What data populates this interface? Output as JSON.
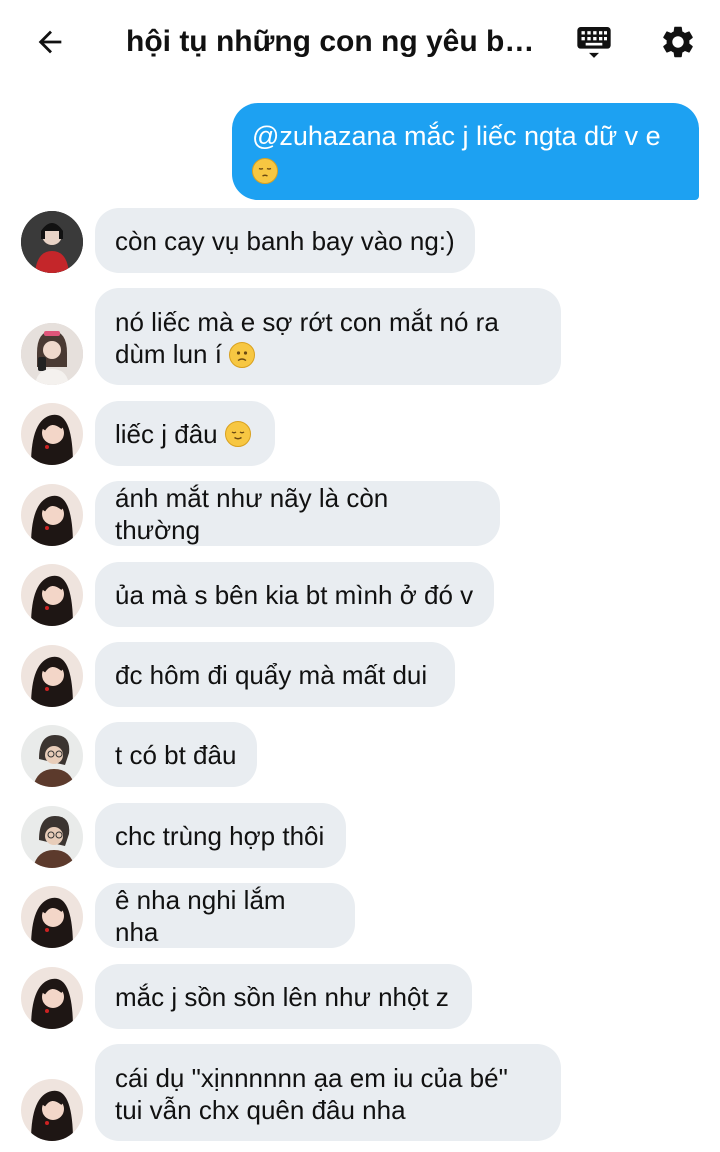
{
  "header": {
    "title": "hội tụ những con ng yêu bồ..."
  },
  "icons": {
    "back": "arrow-left-icon",
    "keyboard": "keyboard-icon",
    "settings": "gear-icon"
  },
  "colors": {
    "outgoing_bubble": "#1da1f2",
    "incoming_bubble": "#e9edf1"
  },
  "messages": [
    {
      "direction": "out",
      "text": "@zuhazana mắc j liếc ngta dữ v e",
      "emoji": "pensive-face"
    },
    {
      "direction": "in",
      "avatar": "user-a",
      "text": "còn cay vụ banh bay vào ng:)"
    },
    {
      "direction": "in",
      "avatar": "user-b",
      "line1": "nó liếc mà e sợ rớt con mắt nó ra",
      "line2": "dùm lun í",
      "emoji": "slightly-frowning-face"
    },
    {
      "direction": "in",
      "avatar": "user-c",
      "text": "liếc j đâu",
      "emoji": "relieved-face"
    },
    {
      "direction": "in",
      "avatar": "user-c",
      "text": "ánh mắt như nãy là còn thường"
    },
    {
      "direction": "in",
      "avatar": "user-c",
      "text": "ủa mà s bên kia bt mình ở đó v"
    },
    {
      "direction": "in",
      "avatar": "user-c",
      "text": "đc hôm đi quẩy mà mất dui"
    },
    {
      "direction": "in",
      "avatar": "user-d",
      "text": "t có bt đâu"
    },
    {
      "direction": "in",
      "avatar": "user-d",
      "text": "chc trùng hợp thôi"
    },
    {
      "direction": "in",
      "avatar": "user-c",
      "text": "ê nha nghi lắm nha"
    },
    {
      "direction": "in",
      "avatar": "user-c",
      "text": "mắc j sồn sồn lên như nhột z"
    },
    {
      "direction": "in",
      "avatar": "user-c",
      "line1": "cái dụ \"xịnnnnnn ạa em iu của bé\"",
      "line2": "tui vẫn chx quên đâu nha"
    }
  ]
}
